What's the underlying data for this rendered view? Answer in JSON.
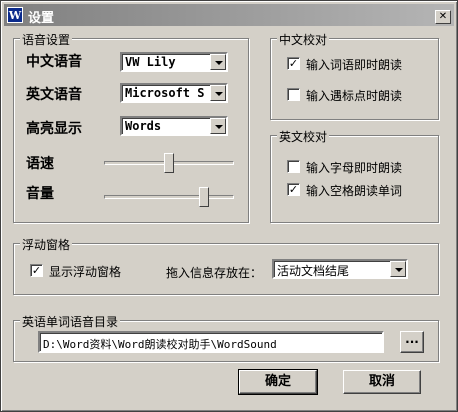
{
  "window": {
    "icon_letter": "W",
    "title": "设置",
    "close_glyph": "✕"
  },
  "voice": {
    "legend": "语音设置",
    "chinese_label": "中文语音",
    "chinese_value": "VW Lily",
    "english_label": "英文语音",
    "english_value": "Microsoft S",
    "highlight_label": "高亮显示",
    "highlight_value": "Words",
    "speed_label": "语速",
    "speed_level": 0.5,
    "volume_label": "音量",
    "volume_level": 0.77
  },
  "chinese_proof": {
    "legend": "中文校对",
    "items": [
      {
        "label": "输入词语即时朗读",
        "checked": true,
        "mark": "✓"
      },
      {
        "label": "输入遇标点时朗读",
        "checked": false,
        "mark": ""
      }
    ]
  },
  "english_proof": {
    "legend": "英文校对",
    "items": [
      {
        "label": "输入字母即时朗读",
        "checked": false,
        "mark": ""
      },
      {
        "label": "输入空格朗读单词",
        "checked": true,
        "mark": "✓"
      }
    ]
  },
  "float": {
    "legend": "浮动窗格",
    "show_label": "显示浮动窗格",
    "show_mark": "✓",
    "drag_label": "拖入信息存放在：",
    "drag_value": "活动文档结尾"
  },
  "dir": {
    "legend": "英语单词语音目录",
    "path": "D:\\Word资料\\Word朗读校对助手\\WordSound",
    "browse_label": "..."
  },
  "buttons": {
    "ok": "确定",
    "cancel": "取消"
  }
}
